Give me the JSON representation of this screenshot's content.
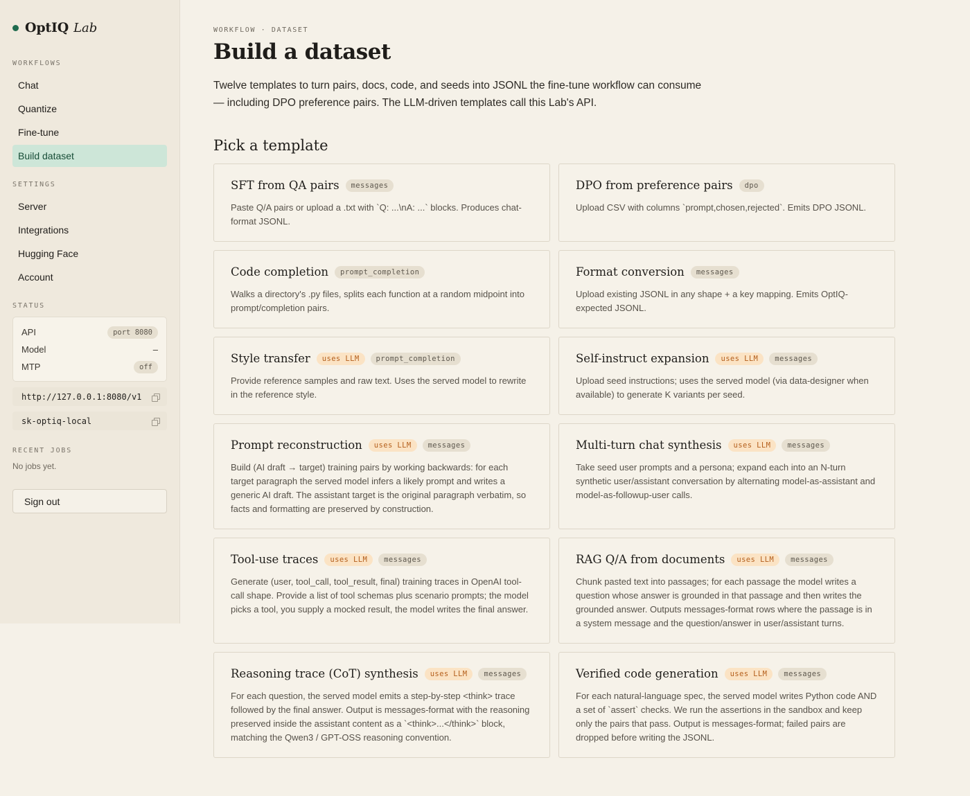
{
  "brand": {
    "name": "OptIQ",
    "suffix": "Lab"
  },
  "sidebar": {
    "workflows_title": "WORKFLOWS",
    "workflows": [
      {
        "label": "Chat"
      },
      {
        "label": "Quantize"
      },
      {
        "label": "Fine-tune"
      },
      {
        "label": "Build dataset",
        "active": true
      }
    ],
    "settings_title": "SETTINGS",
    "settings": [
      {
        "label": "Server"
      },
      {
        "label": "Integrations"
      },
      {
        "label": "Hugging Face"
      },
      {
        "label": "Account"
      }
    ],
    "status_title": "STATUS",
    "status": {
      "api_label": "API",
      "api_value": "port 8080",
      "model_label": "Model",
      "model_value": "–",
      "mtp_label": "MTP",
      "mtp_value": "off"
    },
    "endpoint_url": "http://127.0.0.1:8080/v1",
    "api_key": "sk-optiq-local",
    "recent_title": "RECENT JOBS",
    "recent_empty": "No jobs yet.",
    "signout_label": "Sign out"
  },
  "main": {
    "breadcrumb": "WORKFLOW · DATASET",
    "title": "Build a dataset",
    "intro": "Twelve templates to turn pairs, docs, code, and seeds into JSONL the fine-tune workflow can consume — including DPO preference pairs. The LLM-driven templates call this Lab's API.",
    "pick_title": "Pick a template",
    "llm_tag": "uses LLM",
    "templates": [
      {
        "title": "SFT from QA pairs",
        "llm": false,
        "format": "messages",
        "desc": "Paste Q/A pairs or upload a .txt with `Q: ...\\nA: ...` blocks. Produces chat-format JSONL."
      },
      {
        "title": "DPO from preference pairs",
        "llm": false,
        "format": "dpo",
        "desc": "Upload CSV with columns `prompt,chosen,rejected`. Emits DPO JSONL."
      },
      {
        "title": "Code completion",
        "llm": false,
        "format": "prompt_completion",
        "desc": "Walks a directory's .py files, splits each function at a random midpoint into prompt/completion pairs."
      },
      {
        "title": "Format conversion",
        "llm": false,
        "format": "messages",
        "desc": "Upload existing JSONL in any shape + a key mapping. Emits OptIQ-expected JSONL."
      },
      {
        "title": "Style transfer",
        "llm": true,
        "format": "prompt_completion",
        "desc": "Provide reference samples and raw text. Uses the served model to rewrite in the reference style."
      },
      {
        "title": "Self-instruct expansion",
        "llm": true,
        "format": "messages",
        "desc": "Upload seed instructions; uses the served model (via data-designer when available) to generate K variants per seed."
      },
      {
        "title": "Prompt reconstruction",
        "llm": true,
        "format": "messages",
        "desc": "Build (AI draft → target) training pairs by working backwards: for each target paragraph the served model infers a likely prompt and writes a generic AI draft. The assistant target is the original paragraph verbatim, so facts and formatting are preserved by construction."
      },
      {
        "title": "Multi-turn chat synthesis",
        "llm": true,
        "format": "messages",
        "desc": "Take seed user prompts and a persona; expand each into an N-turn synthetic user/assistant conversation by alternating model-as-assistant and model-as-followup-user calls."
      },
      {
        "title": "Tool-use traces",
        "llm": true,
        "format": "messages",
        "desc": "Generate (user, tool_call, tool_result, final) training traces in OpenAI tool-call shape. Provide a list of tool schemas plus scenario prompts; the model picks a tool, you supply a mocked result, the model writes the final answer."
      },
      {
        "title": "RAG Q/A from documents",
        "llm": true,
        "format": "messages",
        "desc": "Chunk pasted text into passages; for each passage the model writes a question whose answer is grounded in that passage and then writes the grounded answer. Outputs messages-format rows where the passage is in a system message and the question/answer in user/assistant turns."
      },
      {
        "title": "Reasoning trace (CoT) synthesis",
        "llm": true,
        "format": "messages",
        "desc": "For each question, the served model emits a step-by-step <think> trace followed by the final answer. Output is messages-format with the reasoning preserved inside the assistant content as a `<think>...</think>` block, matching the Qwen3 / GPT-OSS reasoning convention."
      },
      {
        "title": "Verified code generation",
        "llm": true,
        "format": "messages",
        "desc": "For each natural-language spec, the served model writes Python code AND a set of `assert` checks. We run the assertions in the sandbox and keep only the pairs that pass. Output is messages-format; failed pairs are dropped before writing the JSONL."
      }
    ]
  }
}
